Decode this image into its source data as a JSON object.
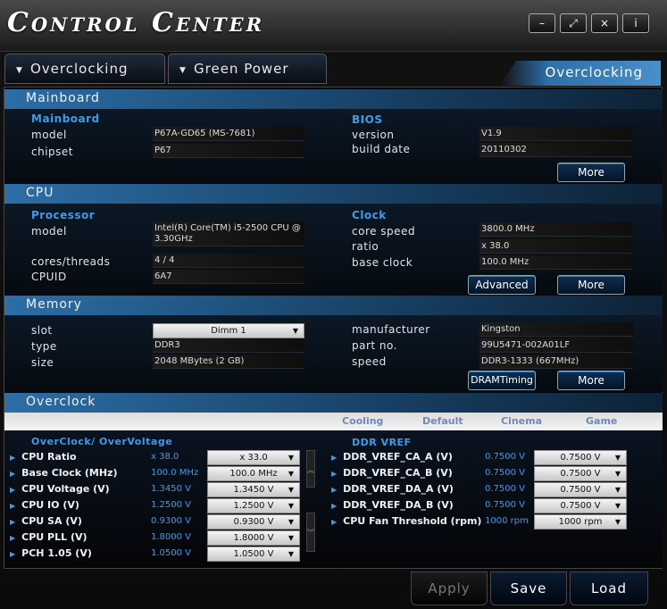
{
  "title": "Control Center",
  "window_buttons": {
    "minimize": "–",
    "fullscreen": "⤢",
    "close": "×",
    "info": "i"
  },
  "tabs": [
    {
      "label": "Overclocking"
    },
    {
      "label": "Green Power"
    }
  ],
  "active_page": "Overclocking",
  "mainboard": {
    "section": "Mainboard",
    "left_header": "Mainboard",
    "model_label": "model",
    "model": "P67A-GD65 (MS-7681)",
    "chipset_label": "chipset",
    "chipset": "P67",
    "bios_header": "BIOS",
    "version_label": "version",
    "version": "V1.9",
    "build_date_label": "build date",
    "build_date": "20110302",
    "more": "More"
  },
  "cpu": {
    "section": "CPU",
    "processor_header": "Processor",
    "model_label": "model",
    "model_line1": "Intel(R) Core(TM) i5-2500 CPU @",
    "model_line2": "3.30GHz",
    "cores_label": "cores/threads",
    "cores": "4 / 4",
    "cpuid_label": "CPUID",
    "cpuid": "6A7",
    "clock_header": "Clock",
    "core_speed_label": "core speed",
    "core_speed": "3800.0 MHz",
    "ratio_label": "ratio",
    "ratio": "x 38.0",
    "base_clock_label": "base clock",
    "base_clock": "100.0 MHz",
    "advanced": "Advanced",
    "more": "More"
  },
  "memory": {
    "section": "Memory",
    "slot_label": "slot",
    "slot": "Dimm 1",
    "type_label": "type",
    "type": "DDR3",
    "size_label": "size",
    "size": "2048 MBytes (2 GB)",
    "manufacturer_label": "manufacturer",
    "manufacturer": "Kingston",
    "part_label": "part no.",
    "part": "99U5471-002A01LF",
    "speed_label": "speed",
    "speed": "DDR3-1333 (667MHz)",
    "dram_timing": "DRAMTiming",
    "more": "More"
  },
  "overclock": {
    "section": "Overclock",
    "presets": [
      "Cooling",
      "Default",
      "Cinema",
      "Game"
    ],
    "left_header": "OverClock/ OverVoltage",
    "right_header": "DDR VREF",
    "left_rows": [
      {
        "label": "CPU Ratio",
        "current": "x 38.0",
        "selected": "x 33.0"
      },
      {
        "label": "Base Clock (MHz)",
        "current": "100.0 MHz",
        "selected": "100.0 MHz"
      },
      {
        "label": "CPU Voltage (V)",
        "current": "1.3450 V",
        "selected": "1.3450 V"
      },
      {
        "label": "CPU IO (V)",
        "current": "1.2500 V",
        "selected": "1.2500 V"
      },
      {
        "label": "CPU SA (V)",
        "current": "0.9300 V",
        "selected": "0.9300 V"
      },
      {
        "label": "CPU PLL (V)",
        "current": "1.8000 V",
        "selected": "1.8000 V"
      },
      {
        "label": "PCH 1.05 (V)",
        "current": "1.0500 V",
        "selected": "1.0500 V"
      }
    ],
    "right_rows": [
      {
        "label": "DDR_VREF_CA_A (V)",
        "current": "0.7500 V",
        "selected": "0.7500 V"
      },
      {
        "label": "DDR_VREF_CA_B (V)",
        "current": "0.7500 V",
        "selected": "0.7500 V"
      },
      {
        "label": "DDR_VREF_DA_A (V)",
        "current": "0.7500 V",
        "selected": "0.7500 V"
      },
      {
        "label": "DDR_VREF_DA_B (V)",
        "current": "0.7500 V",
        "selected": "0.7500 V"
      },
      {
        "label": "CPU Fan Threshold (rpm)",
        "current": "1000 rpm",
        "selected": "1000 rpm"
      }
    ]
  },
  "actions": {
    "apply": "Apply",
    "save": "Save",
    "load": "Load"
  },
  "colors": {
    "accent": "#3f9ae8",
    "header_blue": "#2c6ea6"
  }
}
